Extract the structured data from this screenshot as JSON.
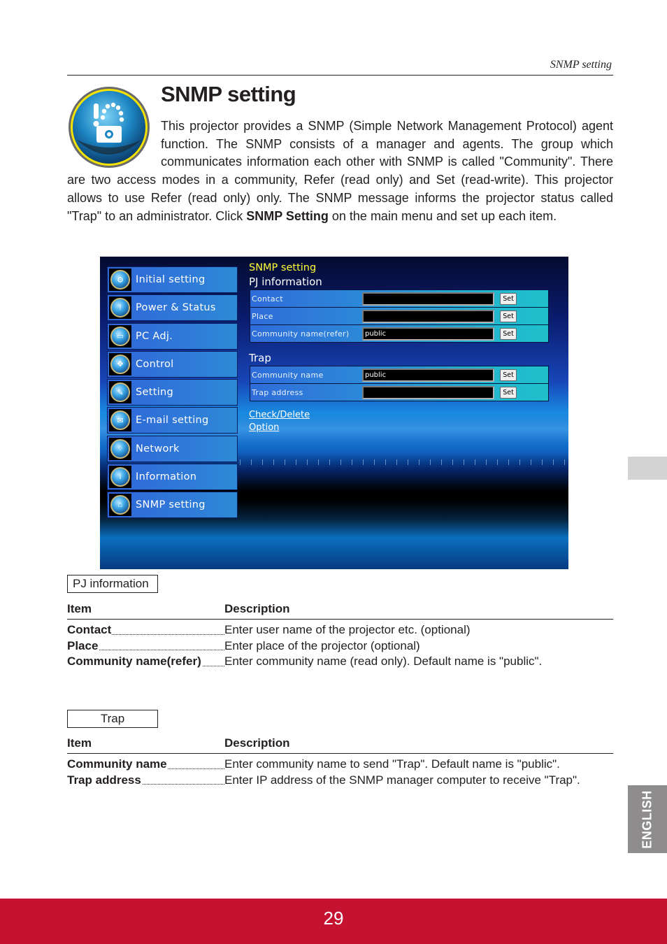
{
  "running_head": "SNMP setting",
  "page_title": "SNMP setting",
  "title_icon": "snmp-setting-icon",
  "intro": {
    "part1": "This projector provides a SNMP (Simple Network Management Protocol) agent function. The SNMP consists of a manager and agents. The group which communicates information each other with SNMP is called \"Community\". There are two access modes in a community, Refer (read only) and Set (read-write). This projector allows to use Refer (read only) only. The SNMP message informs the projector status called \"Trap\" to an administrator. Click ",
    "bold": "SNMP Setting",
    "part2": " on the main menu and set up each item."
  },
  "screenshot": {
    "nav": [
      {
        "label": "Initial setting",
        "icon": "gear-icon",
        "glyph": "⚙"
      },
      {
        "label": "Power & Status",
        "icon": "power-status-icon",
        "glyph": "!"
      },
      {
        "label": "PC Adj.",
        "icon": "monitor-icon",
        "glyph": "▭"
      },
      {
        "label": "Control",
        "icon": "control-pad-icon",
        "glyph": "✥"
      },
      {
        "label": "Setting",
        "icon": "tools-icon",
        "glyph": "✎"
      },
      {
        "label": "E-mail setting",
        "icon": "envelope-icon",
        "glyph": "✉"
      },
      {
        "label": "Network",
        "icon": "network-icon",
        "glyph": "⁘"
      },
      {
        "label": "Information",
        "icon": "info-icon",
        "glyph": "i"
      },
      {
        "label": "SNMP setting",
        "icon": "snmp-icon",
        "glyph": "⌂"
      }
    ],
    "panel_title": "SNMP setting",
    "pj_section": "PJ information",
    "pj_rows": [
      {
        "label": "Contact",
        "value": "",
        "button": "Set"
      },
      {
        "label": "Place",
        "value": "",
        "button": "Set"
      },
      {
        "label": "Community name(refer)",
        "value": "public",
        "button": "Set"
      }
    ],
    "trap_section": "Trap",
    "trap_rows": [
      {
        "label": "Community name",
        "value": "public",
        "button": "Set"
      },
      {
        "label": "Trap address",
        "value": "",
        "button": "Set"
      }
    ],
    "links": [
      "Check/Delete",
      "Option"
    ]
  },
  "pj_table": {
    "box_label": "PJ information",
    "col_item": "Item",
    "col_desc": "Description",
    "rows": [
      {
        "item": "Contact",
        "desc": "Enter user name of the projector etc. (optional)"
      },
      {
        "item": "Place",
        "desc": "Enter place of the projector (optional)"
      },
      {
        "item": "Community name(refer)",
        "desc": "Enter community name (read only). Default name is \"public\"."
      }
    ]
  },
  "trap_table": {
    "box_label": "Trap",
    "col_item": "Item",
    "col_desc": "Description",
    "rows": [
      {
        "item": "Community name",
        "desc": "Enter community name to send \"Trap\". Default name is \"public\"."
      },
      {
        "item": "Trap address",
        "desc": "Enter IP address of the SNMP manager computer to receive \"Trap\"."
      }
    ]
  },
  "language_tab": "ENGLISH",
  "page_number": "29",
  "colors": {
    "footer": "#c41230",
    "lang_tab": "#8e8c8d",
    "panel_title": "#ffff33"
  }
}
